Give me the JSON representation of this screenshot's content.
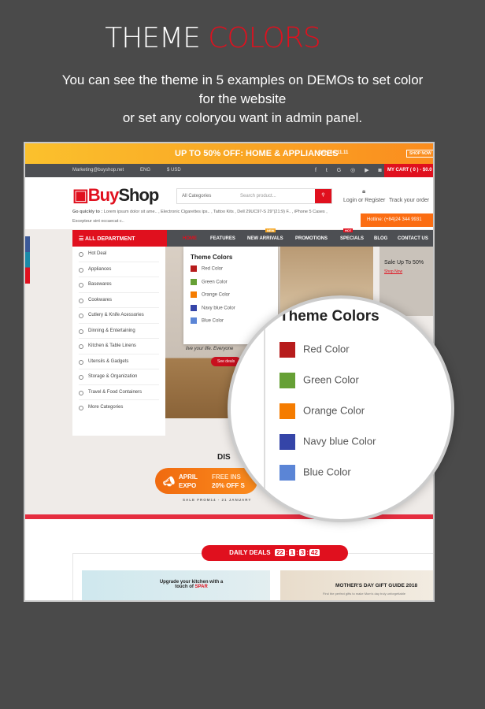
{
  "heading": {
    "part1": "THEME ",
    "part2": "COLORS"
  },
  "subtitle": [
    "You can see the theme in 5 examples on DEMOs to set color",
    "for the website",
    "or set any coloryou want in admin panel."
  ],
  "promo": {
    "text": "UP TO 50% OFF: HOME & APPLIANCES",
    "note": "Only on 11.11",
    "button": "SHOP NOW"
  },
  "topbar": {
    "email": "Marketing@buyshop.net",
    "lang": "ENG",
    "currency": "$ USD",
    "cart": "MY CART ( 0 ) - $0.0"
  },
  "header": {
    "logo_a": "Buy",
    "logo_b": "Shop",
    "category": "All Categories",
    "search_placeholder": "Search product...",
    "login": "Login or Register",
    "track": "Track your order",
    "hotline": "Hotline: (+84)24 344 9931",
    "quick_label": "Go quickly to :",
    "quick_links": "Lorem ipsum dolor sit ame.. , Electronic Cigarettes ips.. , Tattoo Kits , Dell 29UC97-S 29\"(21:9) F.. , iPhone 5 Cases ,",
    "quick_links2": "Excepteur sint occaecat c.."
  },
  "nav": {
    "dept": "ALL DEPARTMENT",
    "items": [
      "HOME",
      "FEATURES",
      "NEW ARRIVALS",
      "PROMOTIONS",
      "SPECIALS",
      "BLOG",
      "CONTACT US"
    ],
    "badge_new": "NEW",
    "badge_hot": "HOT"
  },
  "sidebar": [
    "Hot Deal",
    "Appliances",
    "Basewares",
    "Cookwares",
    "Cutlery & Knife Acessories",
    "Dinning & Entertaining",
    "Kitchen & Table Linens",
    "Utensils & Gadgets",
    "Storage & Organization",
    "Travel & Food Containers",
    "More Categories"
  ],
  "theme": {
    "title": "Theme Colors",
    "colors": [
      {
        "label": "Red Color",
        "hex": "#b71c1c"
      },
      {
        "label": "Green Color",
        "hex": "#66a035"
      },
      {
        "label": "Orange Color",
        "hex": "#f57c00"
      },
      {
        "label": "Navy blue Color",
        "hex": "#3545a8"
      },
      {
        "label": "Blue Color",
        "hex": "#5b85d6"
      }
    ]
  },
  "hero": {
    "tagline": "live your life. Everyone",
    "button": "See deals",
    "sale": "Sale Up To 50%",
    "shop_now": "Shop Now"
  },
  "expo": {
    "disc": "DIS",
    "a": "APRIL",
    "b": "EXPO",
    "c": "FREE INS",
    "d": "20% OFF S",
    "date": "SALE FROM14 - 21 JANUARY"
  },
  "deals": {
    "label": "DAILY DEALS",
    "timer": [
      "22",
      "1",
      "3",
      "42"
    ]
  },
  "banners": {
    "b1": "Upgrade your kitchen with a touch of",
    "b1_brand": "SPAR",
    "b2": "MOTHER'S DAY GIFT GUIDE 2018",
    "b2_sub": "Find the perfect gifts to make Mom's day truly unforgettable"
  }
}
